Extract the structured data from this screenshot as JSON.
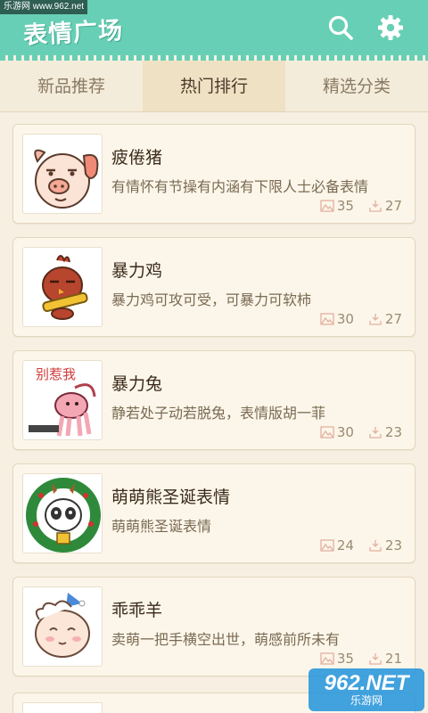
{
  "watermark_top": "乐游网 www.962.net",
  "header": {
    "title": "表情广场",
    "search_icon": "search-icon",
    "settings_icon": "gear-icon",
    "accent": "#67cfb5"
  },
  "tabs": [
    {
      "label": "新品推荐"
    },
    {
      "label": "热门排行"
    },
    {
      "label": "精选分类"
    }
  ],
  "active_tab": "热门排行",
  "items": [
    {
      "title": "疲倦猪",
      "desc": "有情怀有节操有内涵有下限人士必备表情",
      "views": "35",
      "downloads": "27"
    },
    {
      "title": "暴力鸡",
      "desc": "暴力鸡可攻可受，可暴力可软柿",
      "views": "30",
      "downloads": "27"
    },
    {
      "title": "暴力兔",
      "desc": "静若处子动若脱兔，表情版胡一菲",
      "views": "30",
      "downloads": "23",
      "thumb_text": "别惹我"
    },
    {
      "title": "萌萌熊圣诞表情",
      "desc": "萌萌熊圣诞表情",
      "views": "24",
      "downloads": "23"
    },
    {
      "title": "乖乖羊",
      "desc": "卖萌一把手横空出世，萌感前所未有",
      "views": "35",
      "downloads": "21"
    }
  ],
  "watermark_bottom": {
    "main": "962.NET",
    "sub": "乐游网"
  }
}
